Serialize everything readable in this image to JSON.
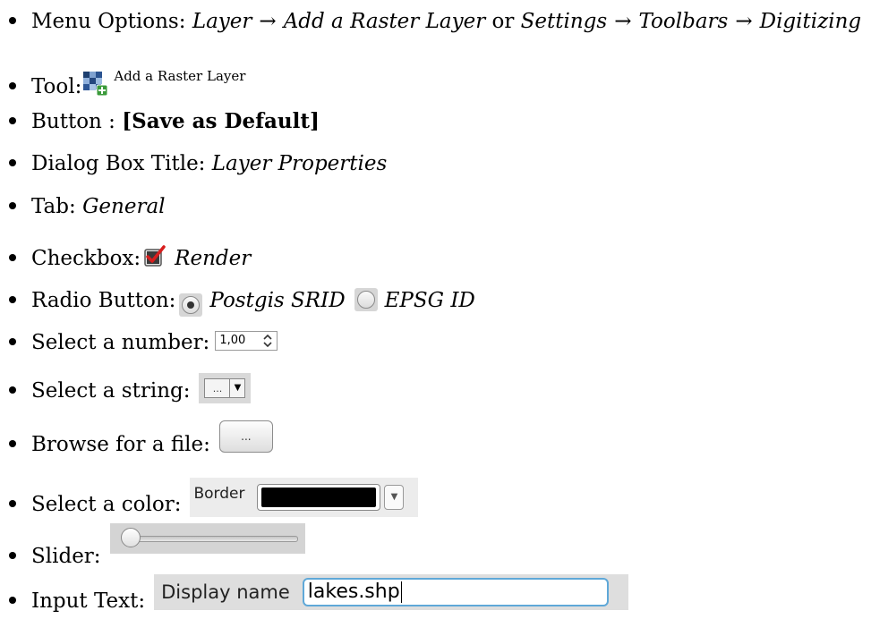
{
  "items": {
    "menu": {
      "label": "Menu Options:",
      "path1": [
        "Layer",
        "Add a Raster Layer"
      ],
      "or_word": "or",
      "path2": [
        "Settings",
        "Toolbars",
        "Digitizing"
      ],
      "arrow": "→"
    },
    "tool": {
      "label": "Tool:",
      "icon": "add-raster-layer-icon",
      "text": "Add a Raster Layer"
    },
    "button": {
      "label": "Button :",
      "value": "[Save as Default]"
    },
    "dialog": {
      "label": "Dialog Box Title:",
      "value": "Layer Properties"
    },
    "tab": {
      "label": "Tab:",
      "value": "General"
    },
    "checkbox": {
      "label": "Checkbox:",
      "value": "Render",
      "icon": "checked-checkbox-icon",
      "checked": true
    },
    "radio": {
      "label": "Radio Button:",
      "option1": "Postgis SRID",
      "option2": "EPSG ID",
      "selected": "Postgis SRID"
    },
    "number": {
      "label": "Select a number:",
      "value": "1,00",
      "icon": "spin-arrows-icon"
    },
    "string": {
      "label": "Select a string:",
      "value": "...",
      "icon": "dropdown-arrow-icon"
    },
    "file": {
      "label": "Browse for a file:",
      "button_text": "..."
    },
    "color": {
      "label": "Select a color:",
      "widget_label": "Border",
      "color_value": "#000000"
    },
    "slider": {
      "label": "Slider:",
      "value": 0
    },
    "input": {
      "label": "Input Text:",
      "field_label": "Display name",
      "value": "lakes.shp"
    }
  }
}
